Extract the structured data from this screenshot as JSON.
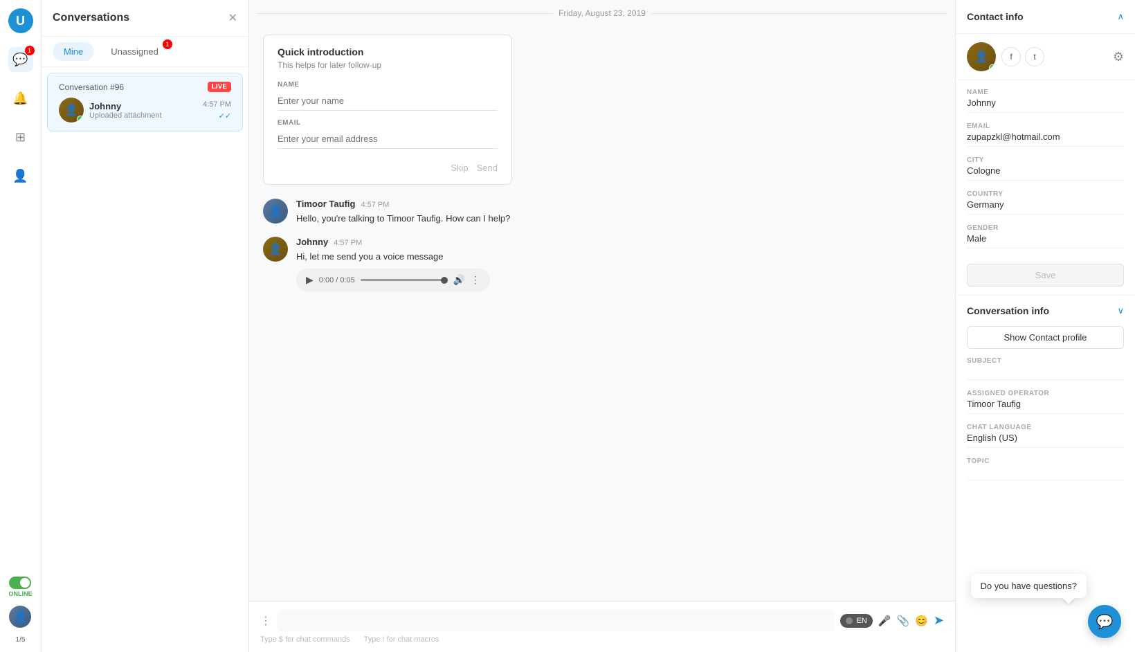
{
  "app": {
    "logo": "U"
  },
  "nav": {
    "badge": "1",
    "page_counter": "1/5",
    "online_label": "ONLINE"
  },
  "conversations_panel": {
    "title": "Conversations",
    "tabs": [
      {
        "id": "mine",
        "label": "Mine",
        "active": true
      },
      {
        "id": "unassigned",
        "label": "Unassigned",
        "active": false,
        "badge": "1"
      }
    ],
    "conversation": {
      "id": "Conversation #96",
      "live_badge": "LIVE",
      "contact_name": "Johnny",
      "time": "4:57 PM",
      "preview": "Uploaded attachment",
      "check": "✓✓"
    }
  },
  "chat": {
    "date_divider": "Friday, August 23, 2019",
    "quick_intro": {
      "title": "Quick introduction",
      "subtitle": "This helps for later follow-up",
      "name_label": "NAME",
      "name_placeholder": "Enter your name",
      "email_label": "EMAIL",
      "email_placeholder": "Enter your email address",
      "skip_label": "Skip",
      "send_label": "Send"
    },
    "messages": [
      {
        "sender": "Timoor Taufig",
        "time": "4:57 PM",
        "text": "Hello, you're talking to Timoor Taufig. How can I help?",
        "type": "agent"
      },
      {
        "sender": "Johnny",
        "time": "4:57 PM",
        "text": "Hi, let me send you a voice message",
        "type": "visitor",
        "has_audio": true,
        "audio_time": "0:00 / 0:05"
      }
    ],
    "input": {
      "placeholder": "",
      "language": "EN",
      "hints": [
        "Type $ for chat commands",
        "Type ! for chat macros"
      ]
    }
  },
  "contact_info": {
    "title": "Contact info",
    "name_label": "NAME",
    "name_value": "Johnny",
    "email_label": "EMAIL",
    "email_value": "zupapzkl@hotmail.com",
    "city_label": "CITY",
    "city_value": "Cologne",
    "country_label": "COUNTRY",
    "country_value": "Germany",
    "gender_label": "GENDER",
    "gender_value": "Male",
    "save_label": "Save"
  },
  "conversation_info": {
    "title": "Conversation info",
    "show_profile_label": "Show Contact profile",
    "subject_label": "SUBJECT",
    "subject_value": "",
    "assigned_operator_label": "ASSIGNED OPERATOR",
    "assigned_operator_value": "Timoor Taufig",
    "chat_language_label": "CHAT LANGUAGE",
    "chat_language_value": "English (US)",
    "topic_label": "TOPIC"
  },
  "chat_widget": {
    "tooltip": "Do you have questions?"
  }
}
